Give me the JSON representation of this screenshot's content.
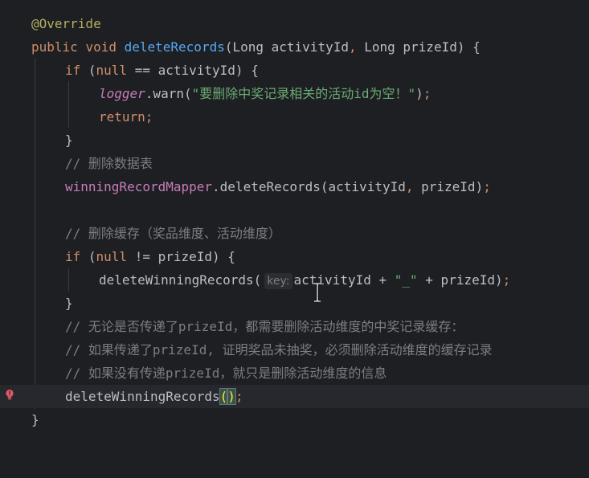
{
  "code": {
    "annotation": "@Override",
    "kw_public": "public",
    "kw_void": "void",
    "method_name": "deleteRecords",
    "params_open": "(Long activityId",
    "comma1": ",",
    "params_rest": " Long prizeId) {",
    "kw_if": "if",
    "if1_open": " (",
    "kw_null": "null",
    "if1_rest": " == activityId) {",
    "logger": "logger",
    "warn_call": ".warn(",
    "warn_string": "\"要删除中奖记录相关的活动id为空！\"",
    "warn_close": ")",
    "semicolon": ";",
    "kw_return": "return",
    "close_brace": "}",
    "comment1": "// 删除数据表",
    "mapper": "winningRecordMapper",
    "mapper_call": ".deleteRecords(activityId",
    "mapper_rest": " prizeId)",
    "comment2": "// 删除缓存（奖品维度、活动维度）",
    "if2_open": " (",
    "if2_rest": " != prizeId) {",
    "dwr_call": "deleteWinningRecords(",
    "param_hint": "key:",
    "dwr_args": "activityId + ",
    "underscore_str": "\"_\"",
    "dwr_args_rest": " + prizeId)",
    "comment3": "// 无论是否传递了prizeId，都需要删除活动维度的中奖记录缓存：",
    "comment4": "// 如果传递了prizeId, 证明奖品未抽奖，必须删除活动维度的缓存记录",
    "comment5": "// 如果没有传递prizeId，就只是删除活动维度的信息",
    "dwr_call2": "deleteWinningRecords",
    "paren_open": "(",
    "paren_close": ")"
  },
  "colors": {
    "background": "#1e1f22",
    "keyword": "#cf8e6d",
    "annotation": "#b3ae60",
    "method": "#56a8f5",
    "field": "#c77dbb",
    "string": "#6aab73",
    "comment": "#7a7e85",
    "text": "#bcbec4",
    "error_icon": "#e55765"
  },
  "icons": {
    "gutter": "error-bulb-icon",
    "mouse": "text-cursor-icon"
  }
}
